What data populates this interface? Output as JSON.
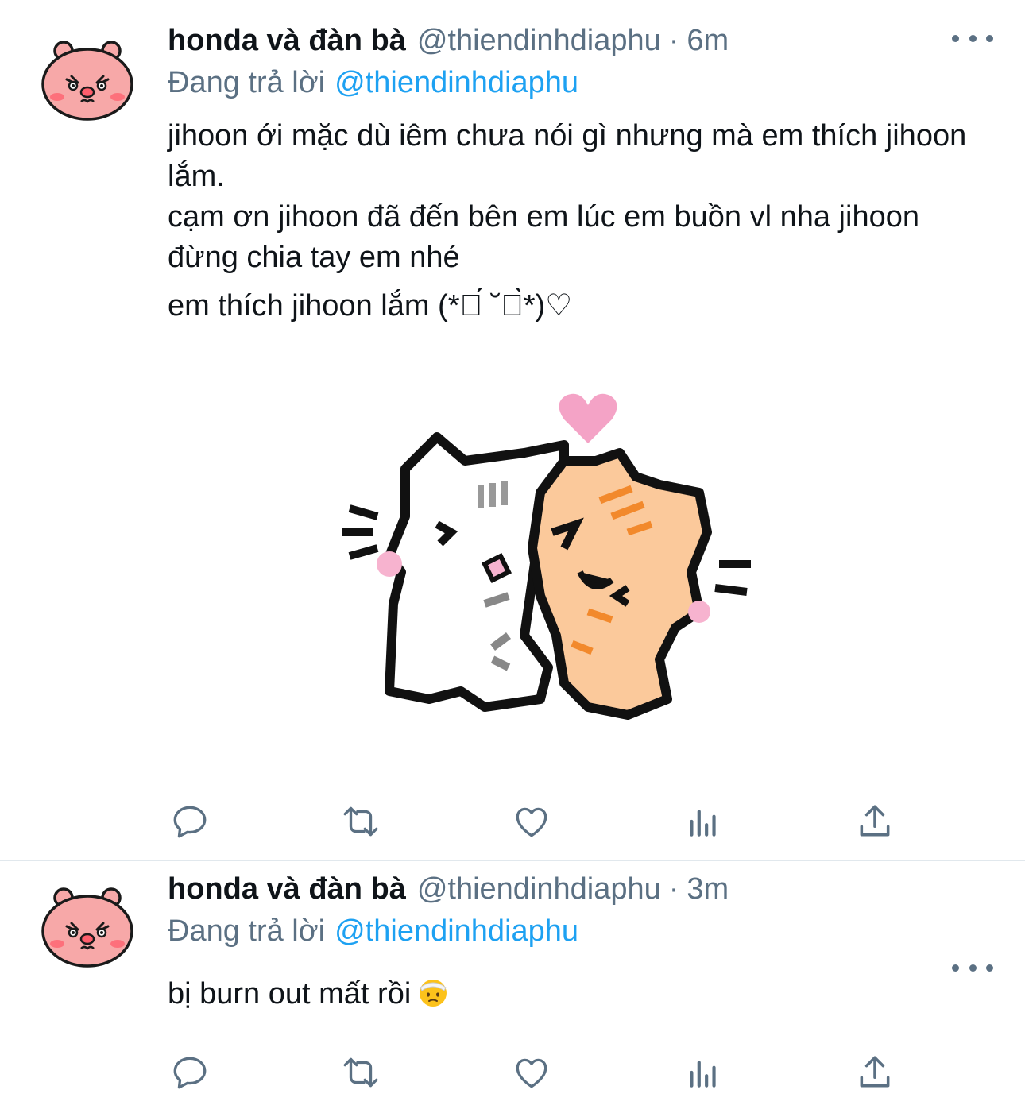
{
  "tweets": [
    {
      "display_name": "honda và đàn bà",
      "handle": "@thiendinhdiaphu",
      "separator": "·",
      "time": "6m",
      "reply_prefix": "Đang trả lời",
      "reply_to": "@thiendinhdiaphu",
      "text_lines": [
        "jihoon ới mặc dù iêm chưa nói gì nhưng mà em thích jihoon lắm.",
        "cạm ơn jihoon đã đến bên em lúc em buồn vl nha jihoon đừng chia tay em nhé",
        "em thích jihoon lắm (*ค́ ˘ค̀*)♡"
      ],
      "has_media": true,
      "media_icon": "hugging-cats-sticker"
    },
    {
      "display_name": "honda và đàn bà",
      "handle": "@thiendinhdiaphu",
      "separator": "·",
      "time": "3m",
      "reply_prefix": "Đang trả lời",
      "reply_to": "@thiendinhdiaphu",
      "text_lines": [
        "bị burn out mất rồi"
      ],
      "trailing_emoji": "face-with-head-bandage-emoji"
    }
  ],
  "icons": {
    "reply": "reply-icon",
    "retweet": "retweet-icon",
    "like": "heart-icon",
    "stats": "analytics-icon",
    "share": "share-icon",
    "more": "more-icon"
  },
  "colors": {
    "link": "#1da1f2",
    "secondary_text": "#5b7083",
    "primary_text": "#0f1419",
    "divider": "#e1e8ed"
  }
}
